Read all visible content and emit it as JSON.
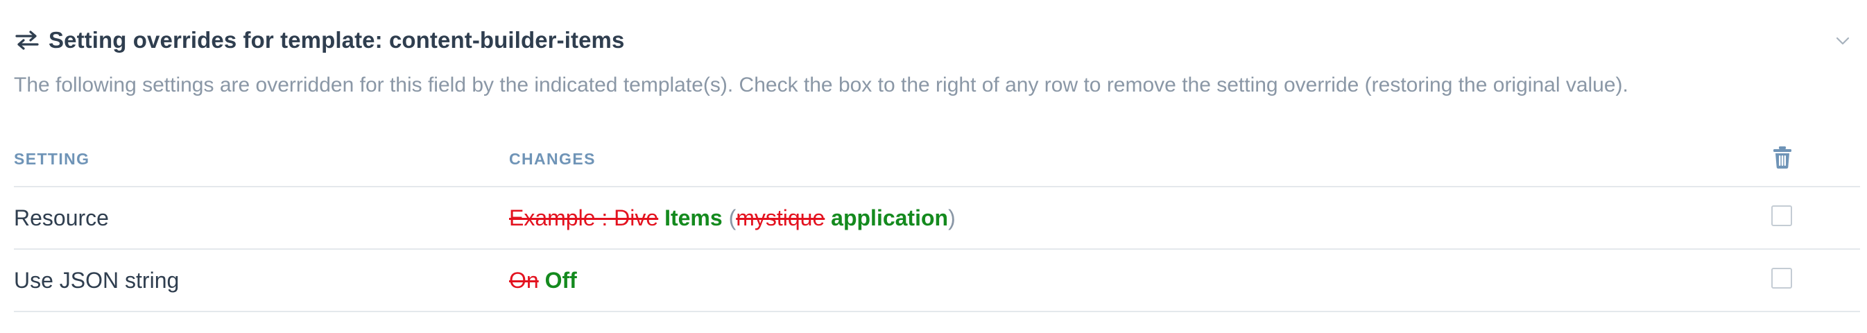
{
  "header": {
    "icon": "swap-arrows-icon",
    "title": "Setting overrides for template: content-builder-items",
    "collapse_icon": "chevron-down-icon"
  },
  "description": "The following settings are overridden for this field by the indicated template(s). Check the box to the right of any row to remove the setting override (restoring the original value).",
  "table": {
    "columns": {
      "setting": "SETTING",
      "changes": "CHANGES",
      "remove_icon": "trash-icon"
    },
    "rows": [
      {
        "setting": "Resource",
        "changes": {
          "removed_1": "Example : Dive",
          "added_1": "Items",
          "paren_open": "(",
          "removed_2": "mystique",
          "added_2": "application",
          "paren_close": ")"
        },
        "checked": false
      },
      {
        "setting": "Use JSON string",
        "changes": {
          "removed_1": "On",
          "added_1": "Off"
        },
        "checked": false
      }
    ]
  },
  "colors": {
    "removed": "#e3121f",
    "added": "#148a1e",
    "header_text": "#6f94b7",
    "muted": "#8a97a6"
  }
}
